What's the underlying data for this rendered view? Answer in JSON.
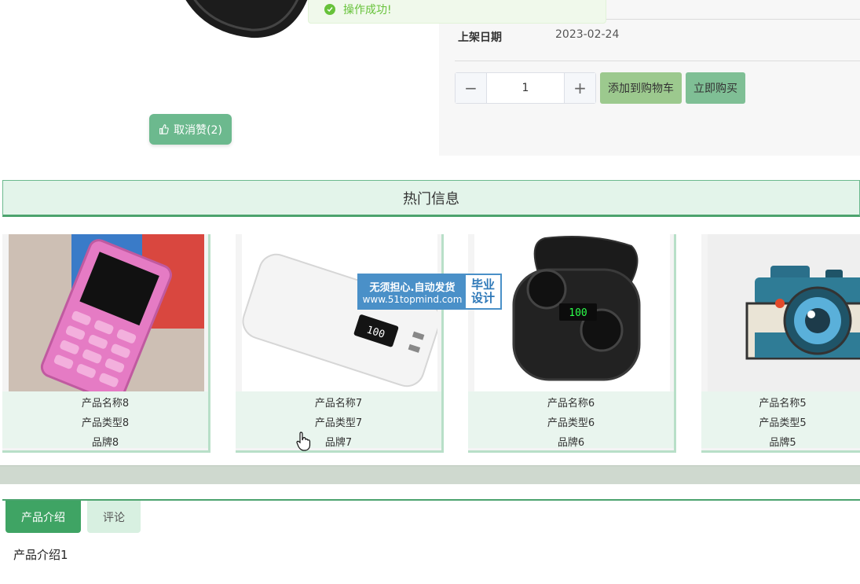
{
  "toast": {
    "message": "操作成功!"
  },
  "like_button": {
    "label": "取消赞(2)"
  },
  "info": {
    "shelf_date_label": "上架日期",
    "shelf_date_value": "2023-02-24",
    "quantity": "1",
    "add_to_cart_label": "添加到购物车",
    "buy_now_label": "立即购买"
  },
  "hot": {
    "title": "热门信息",
    "cards": [
      {
        "name": "产品名称8",
        "type": "产品类型8",
        "brand": "品牌8",
        "image": "pink-phone-icon"
      },
      {
        "name": "产品名称7",
        "type": "产品类型7",
        "brand": "品牌7",
        "image": "power-bank-icon"
      },
      {
        "name": "产品名称6",
        "type": "产品类型6",
        "brand": "品牌6",
        "image": "earbuds-case-icon"
      },
      {
        "name": "产品名称5",
        "type": "产品类型5",
        "brand": "品牌5",
        "image": "camera-icon"
      }
    ]
  },
  "watermark": {
    "line1": "无须担心.自动发货",
    "line2": "www.51topmind.com",
    "right1": "毕业",
    "right2": "设计"
  },
  "tabs": [
    {
      "label": "产品介绍"
    },
    {
      "label": "评论"
    }
  ],
  "intro": {
    "text": "产品介绍1"
  },
  "colors": {
    "accent": "#3fa464",
    "toast_green": "#67c23a",
    "header_bg": "#e3f4ea"
  }
}
